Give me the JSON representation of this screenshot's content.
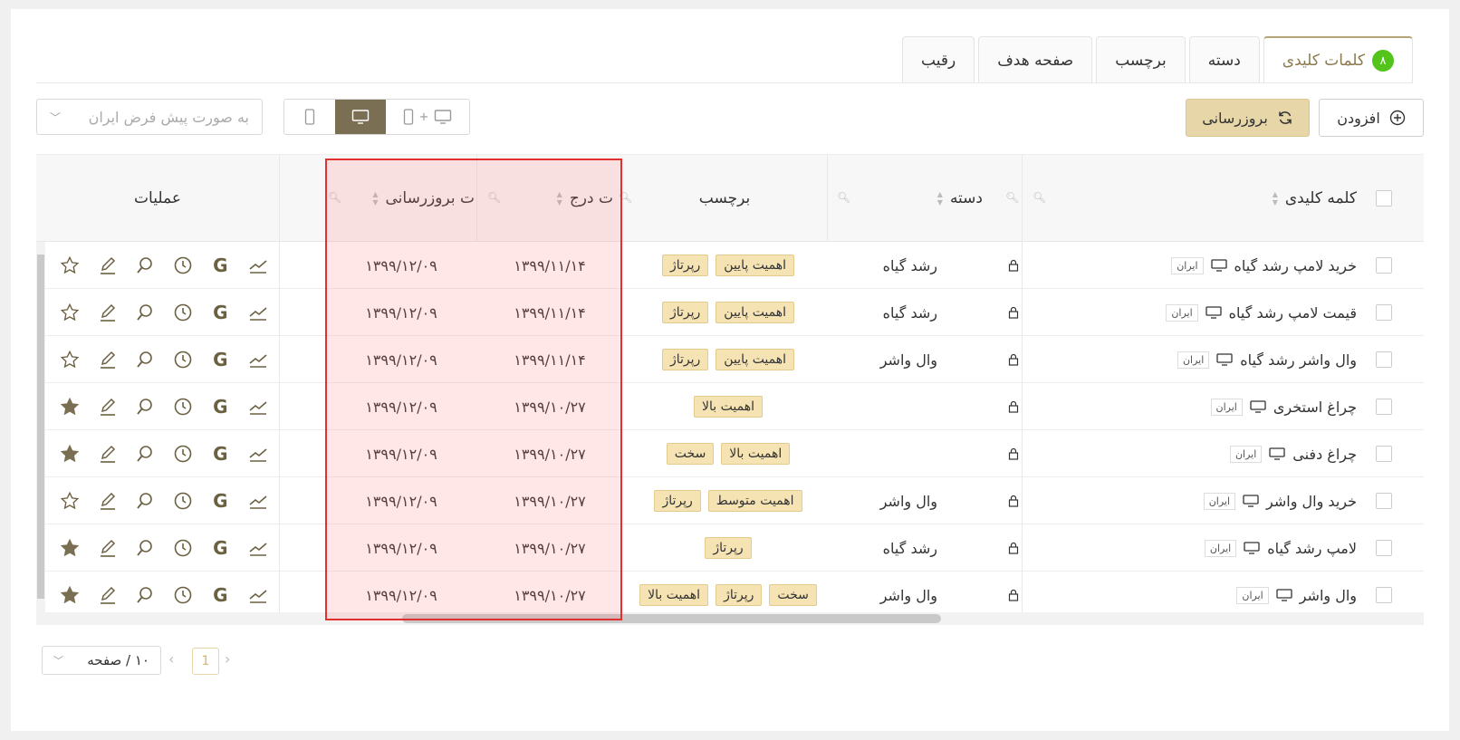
{
  "tabs": [
    {
      "label": "کلمات کلیدی",
      "count": "۸",
      "active": true
    },
    {
      "label": "دسته"
    },
    {
      "label": "برچسب"
    },
    {
      "label": "صفحه هدف"
    },
    {
      "label": "رقیب"
    }
  ],
  "toolbar": {
    "add_label": "افزودن",
    "refresh_label": "بروزرسانی",
    "region_placeholder": "به صورت پیش فرض ایران",
    "device_options": [
      "desktop+mobile",
      "desktop",
      "mobile"
    ],
    "device_selected": "desktop"
  },
  "table": {
    "headers": {
      "keyword": "کلمه کلیدی",
      "category": "دسته",
      "tags": "برچسب",
      "insert_date": "ت درج",
      "update_date": "ت بروزرسانی",
      "operations": "عملیات"
    },
    "rows": [
      {
        "keyword": "خرید لامپ رشد گیاه",
        "region": "ایران",
        "category": "رشد گیاه",
        "tags": [
          "اهمیت پایین",
          "رپرتاژ"
        ],
        "insert_date": "۱۳۹۹/۱۱/۱۴",
        "update_date": "۱۳۹۹/۱۲/۰۹",
        "starred": false
      },
      {
        "keyword": "قیمت لامپ رشد گیاه",
        "region": "ایران",
        "category": "رشد گیاه",
        "tags": [
          "اهمیت پایین",
          "رپرتاژ"
        ],
        "insert_date": "۱۳۹۹/۱۱/۱۴",
        "update_date": "۱۳۹۹/۱۲/۰۹",
        "starred": false
      },
      {
        "keyword": "وال واشر رشد گیاه",
        "region": "ایران",
        "category": "وال واشر",
        "tags": [
          "اهمیت پایین",
          "رپرتاژ"
        ],
        "insert_date": "۱۳۹۹/۱۱/۱۴",
        "update_date": "۱۳۹۹/۱۲/۰۹",
        "starred": false
      },
      {
        "keyword": "چراغ استخری",
        "region": "ایران",
        "category": "",
        "tags": [
          "اهمیت بالا"
        ],
        "insert_date": "۱۳۹۹/۱۰/۲۷",
        "update_date": "۱۳۹۹/۱۲/۰۹",
        "starred": true
      },
      {
        "keyword": "چراغ دفنی",
        "region": "ایران",
        "category": "",
        "tags": [
          "اهمیت بالا",
          "سخت"
        ],
        "insert_date": "۱۳۹۹/۱۰/۲۷",
        "update_date": "۱۳۹۹/۱۲/۰۹",
        "starred": true
      },
      {
        "keyword": "خرید وال واشر",
        "region": "ایران",
        "category": "وال واشر",
        "tags": [
          "اهمیت متوسط",
          "رپرتاژ"
        ],
        "insert_date": "۱۳۹۹/۱۰/۲۷",
        "update_date": "۱۳۹۹/۱۲/۰۹",
        "starred": false
      },
      {
        "keyword": "لامپ رشد گیاه",
        "region": "ایران",
        "category": "رشد گیاه",
        "tags": [
          "رپرتاژ"
        ],
        "insert_date": "۱۳۹۹/۱۰/۲۷",
        "update_date": "۱۳۹۹/۱۲/۰۹",
        "starred": true
      },
      {
        "keyword": "وال واشر",
        "region": "ایران",
        "category": "وال واشر",
        "tags": [
          "سخت",
          "رپرتاژ",
          "اهمیت بالا"
        ],
        "insert_date": "۱۳۹۹/۱۰/۲۷",
        "update_date": "۱۳۹۹/۱۲/۰۹",
        "starred": true
      }
    ]
  },
  "pagination": {
    "page_size": "۱۰ / صفحه",
    "current_page": "1"
  },
  "colors": {
    "accent": "#b5a478",
    "highlight_border": "#e03030",
    "tag_bg": "#f5e3b4",
    "success": "#52c41a"
  }
}
